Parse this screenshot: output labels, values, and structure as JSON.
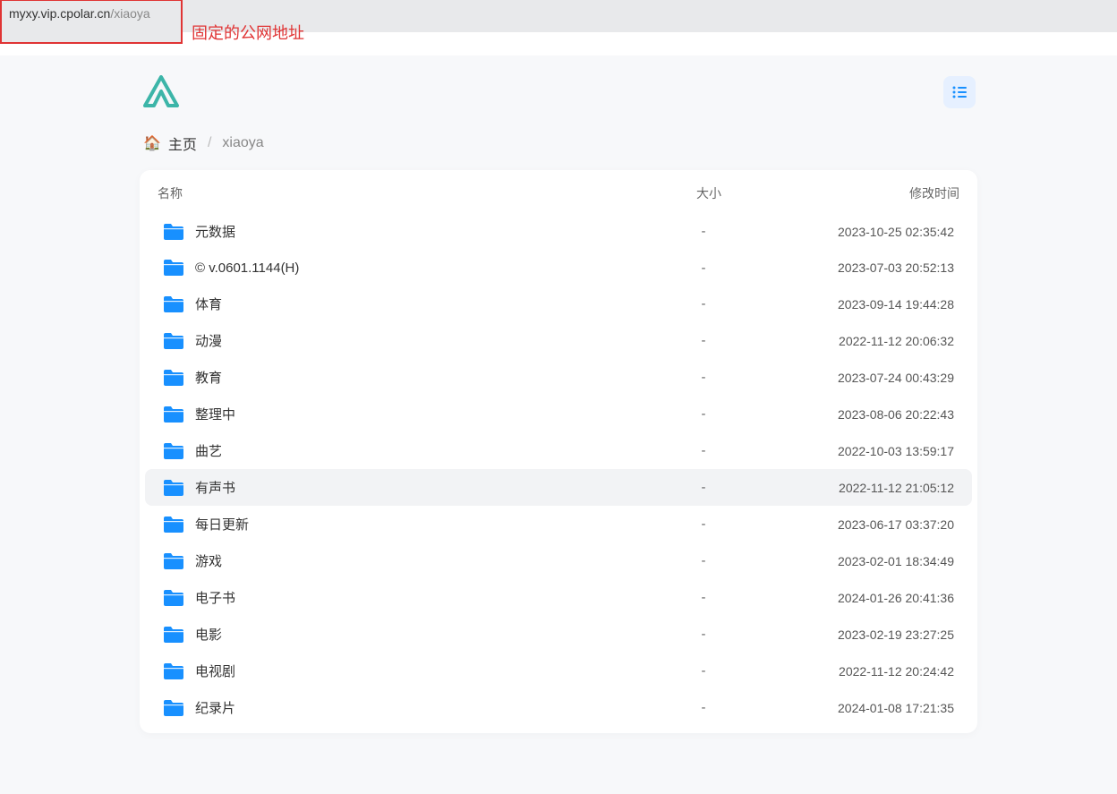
{
  "address_bar": {
    "url_main": "myxy.vip.cpolar.cn",
    "url_path": "/xiaoya"
  },
  "annotation": "固定的公网地址",
  "breadcrumb": {
    "home_label": "主页",
    "separator": "/",
    "current": "xiaoya"
  },
  "table": {
    "header_name": "名称",
    "header_size": "大小",
    "header_date": "修改时间"
  },
  "files": [
    {
      "name": "元数据",
      "size": "-",
      "date": "2023-10-25 02:35:42",
      "hovered": false
    },
    {
      "name": "© v.0601.1144(H)",
      "size": "-",
      "date": "2023-07-03 20:52:13",
      "hovered": false
    },
    {
      "name": "体育",
      "size": "-",
      "date": "2023-09-14 19:44:28",
      "hovered": false
    },
    {
      "name": "动漫",
      "size": "-",
      "date": "2022-11-12 20:06:32",
      "hovered": false
    },
    {
      "name": "教育",
      "size": "-",
      "date": "2023-07-24 00:43:29",
      "hovered": false
    },
    {
      "name": "整理中",
      "size": "-",
      "date": "2023-08-06 20:22:43",
      "hovered": false
    },
    {
      "name": "曲艺",
      "size": "-",
      "date": "2022-10-03 13:59:17",
      "hovered": false
    },
    {
      "name": "有声书",
      "size": "-",
      "date": "2022-11-12 21:05:12",
      "hovered": true
    },
    {
      "name": "每日更新",
      "size": "-",
      "date": "2023-06-17 03:37:20",
      "hovered": false
    },
    {
      "name": "游戏",
      "size": "-",
      "date": "2023-02-01 18:34:49",
      "hovered": false
    },
    {
      "name": "电子书",
      "size": "-",
      "date": "2024-01-26 20:41:36",
      "hovered": false
    },
    {
      "name": "电影",
      "size": "-",
      "date": "2023-02-19 23:27:25",
      "hovered": false
    },
    {
      "name": "电视剧",
      "size": "-",
      "date": "2022-11-12 20:24:42",
      "hovered": false
    },
    {
      "name": "纪录片",
      "size": "-",
      "date": "2024-01-08 17:21:35",
      "hovered": false
    }
  ]
}
